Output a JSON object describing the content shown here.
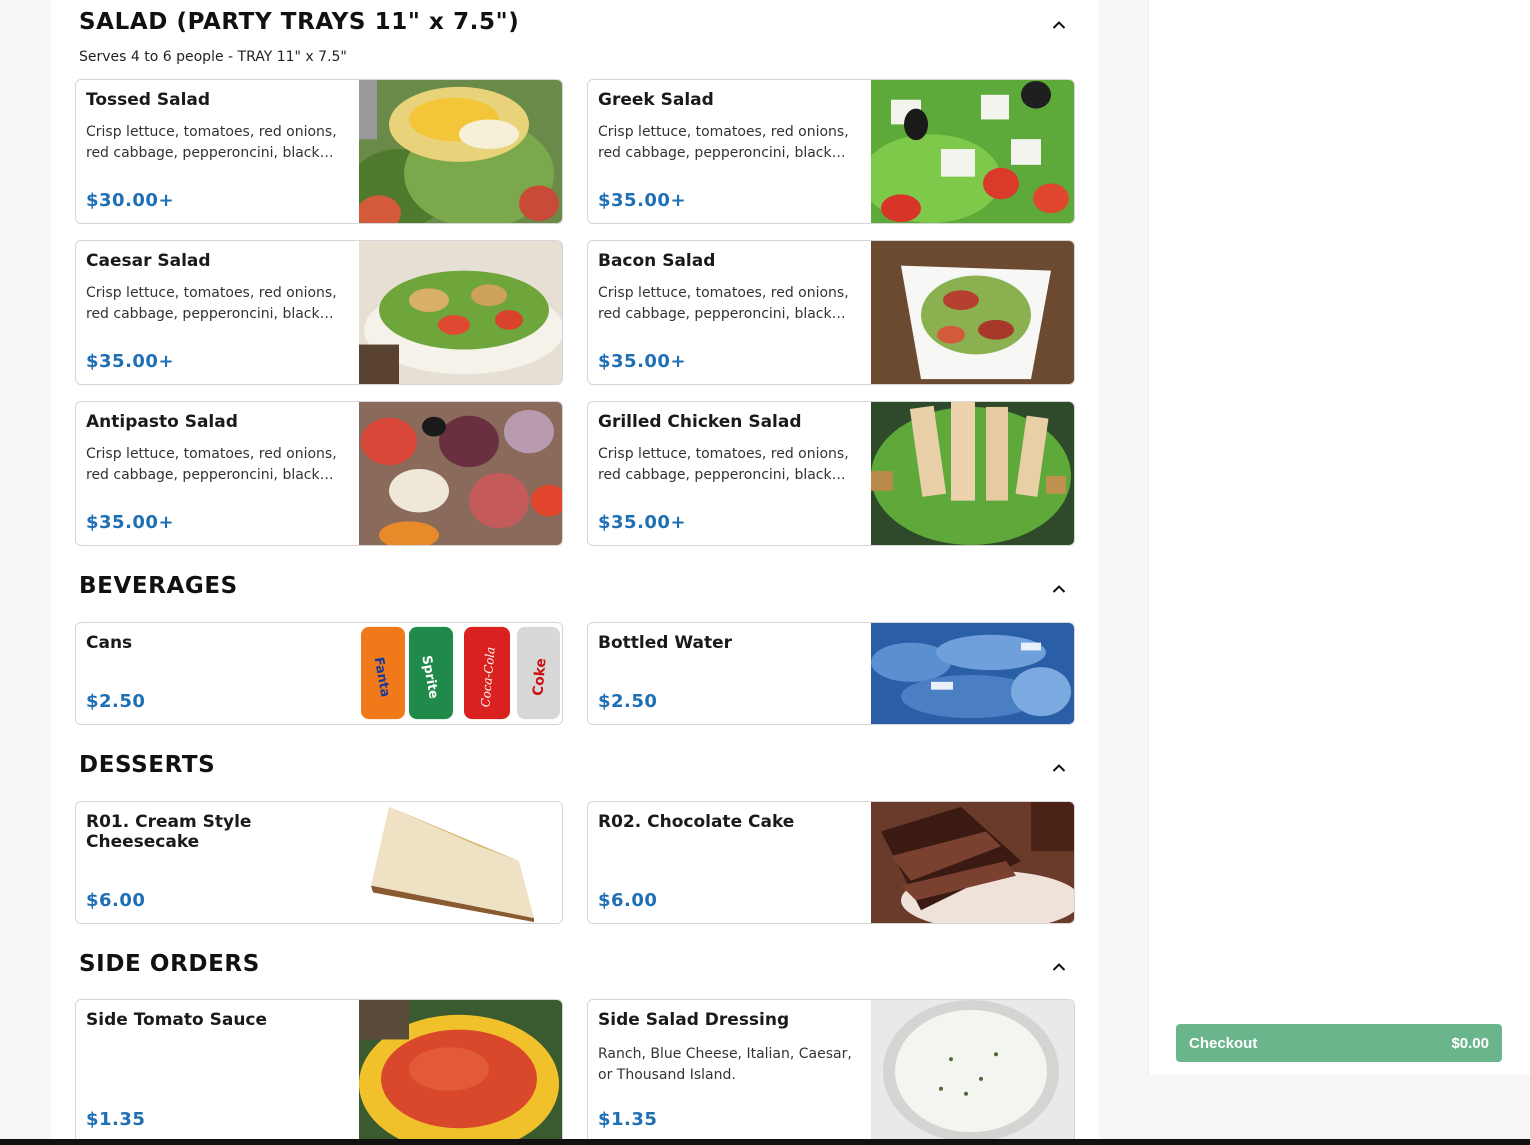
{
  "sections": {
    "salad": {
      "title": "SALAD (PARTY TRAYS 11\" x 7.5\")",
      "subtitle": "Serves 4 to 6 people - TRAY 11\" x 7.5\"",
      "items": [
        {
          "name": "Tossed Salad",
          "desc": "Crisp lettuce, tomatoes, red onions, red cabbage, pepperoncini, black olives",
          "price": "$30.00+"
        },
        {
          "name": "Greek Salad",
          "desc": "Crisp lettuce, tomatoes, red onions, red cabbage, pepperoncini, black olives",
          "price": "$35.00+"
        },
        {
          "name": "Caesar Salad",
          "desc": "Crisp lettuce, tomatoes, red onions, red cabbage, pepperoncini, black olives",
          "price": "$35.00+"
        },
        {
          "name": "Bacon Salad",
          "desc": "Crisp lettuce, tomatoes, red onions, red cabbage, pepperoncini, black olives",
          "price": "$35.00+"
        },
        {
          "name": "Antipasto Salad",
          "desc": "Crisp lettuce, tomatoes, red onions, red cabbage, pepperoncini, black olives",
          "price": "$35.00+"
        },
        {
          "name": "Grilled Chicken Salad",
          "desc": "Crisp lettuce, tomatoes, red onions, red cabbage, pepperoncini, black olives",
          "price": "$35.00+"
        }
      ]
    },
    "beverages": {
      "title": "BEVERAGES",
      "items": [
        {
          "name": "Cans",
          "price": "$2.50"
        },
        {
          "name": "Bottled Water",
          "price": "$2.50"
        }
      ]
    },
    "desserts": {
      "title": "DESSERTS",
      "items": [
        {
          "name": "R01. Cream Style Cheesecake",
          "price": "$6.00"
        },
        {
          "name": "R02. Chocolate Cake",
          "price": "$6.00"
        }
      ]
    },
    "side_orders": {
      "title": "SIDE ORDERS",
      "items": [
        {
          "name": "Side Tomato Sauce",
          "price": "$1.35"
        },
        {
          "name": "Side Salad Dressing",
          "desc": "Ranch, Blue Cheese, Italian, Caesar, or Thousand Island.",
          "price": "$1.35"
        }
      ]
    }
  },
  "cans_labels": [
    "Fanta",
    "Sprite",
    "Coca-Cola",
    "Coke"
  ],
  "cart": {
    "checkout_label": "Checkout",
    "total": "$0.00"
  },
  "colors": {
    "price": "#1f6fb5",
    "checkout": "#6bb58c"
  },
  "icons": {
    "collapse": "chevron-up-icon"
  }
}
